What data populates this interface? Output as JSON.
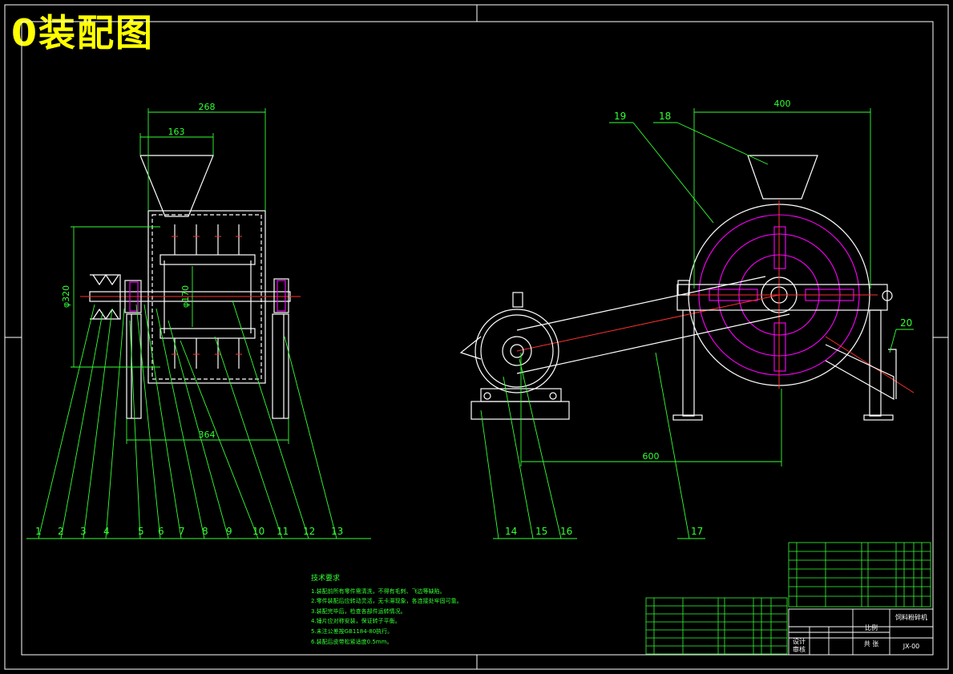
{
  "title": "0装配图",
  "dimensions": {
    "left_width_268": "268",
    "left_hopper_163": "163",
    "left_dia_320": "φ320",
    "left_dia_170": "φ170",
    "left_width_364": "364",
    "right_width_400": "400",
    "right_dist_600": "600"
  },
  "balloons_left": [
    "1",
    "2",
    "3",
    "4",
    "5",
    "6",
    "7",
    "8",
    "9",
    "10",
    "11",
    "12",
    "13"
  ],
  "balloons_right": [
    "14",
    "15",
    "16",
    "17"
  ],
  "balloons_top": [
    "19",
    "18",
    "20"
  ],
  "tech_requirements": {
    "heading": "技术要求",
    "items": [
      "1.装配前所有零件需清洗，不得有毛刺、飞边等缺陷。",
      "2.零件装配后应转动灵活，无卡滞现象，各连接处牢固可靠。",
      "3.装配完毕后，检查各部件运转情况。",
      "4.锤片应对称安装，保证转子平衡。",
      "5.未注公差按GB1184-80执行。",
      "6.装配后皮带松紧适度0.5mm。"
    ]
  },
  "title_block": {
    "drawing_name": "饲料粉碎机",
    "drawing_no": "JX-00",
    "scale_label": "比例",
    "sheet_label": "共 张",
    "designer_label": "设计",
    "checker_label": "审核"
  }
}
